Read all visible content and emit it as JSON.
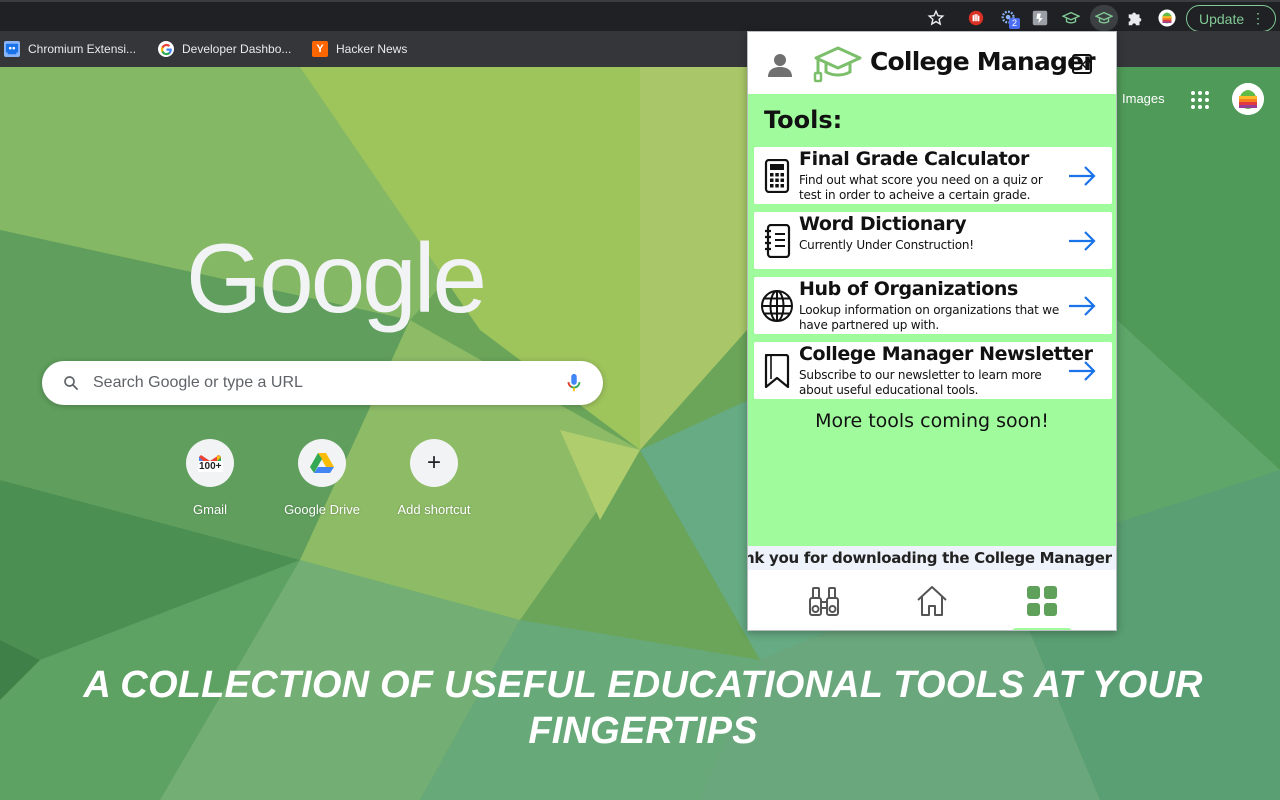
{
  "browser": {
    "update_label": "Update",
    "more_icon": "more-vert-icon"
  },
  "bookmarks": [
    {
      "label": "Chromium Extensi...",
      "icon": "chromium-extensions-favicon"
    },
    {
      "label": "Developer Dashbo...",
      "icon": "google-favicon"
    },
    {
      "label": "Hacker News",
      "icon": "hacker-news-favicon",
      "badge": "Y"
    }
  ],
  "ntp": {
    "logo": "Google",
    "images_link": "Images",
    "search_placeholder": "Search Google or type a URL",
    "shortcuts": [
      {
        "label": "Gmail",
        "badge": "100+"
      },
      {
        "label": "Google Drive"
      },
      {
        "label": "Add shortcut",
        "glyph": "+"
      }
    ]
  },
  "extension_badge": "2",
  "popup": {
    "title": "College Manager",
    "tools_heading": "Tools:",
    "tools": [
      {
        "title": "Final Grade Calculator",
        "desc": "Find out what score you need on a quiz or test in order to acheive a certain grade.",
        "icon": "calculator-icon"
      },
      {
        "title": "Word Dictionary",
        "desc": "Currently Under Construction!",
        "icon": "notebook-icon"
      },
      {
        "title": "Hub of Organizations",
        "desc": "Lookup information on organizations that we have partnered up with.",
        "icon": "globe-icon"
      },
      {
        "title": "College Manager Newsletter",
        "desc": "Subscribe to our newsletter to learn more about useful educational tools.",
        "icon": "bookmark-icon"
      }
    ],
    "more_text": "More tools coming soon!",
    "marquee": "nk you for downloading the College Manager Chrome Extension!",
    "nav": [
      "binoculars-icon",
      "home-icon",
      "grid-icon"
    ]
  },
  "tagline": {
    "line1": "A COLLECTION OF USEFUL EDUCATIONAL TOOLS AT YOUR",
    "line2": "FINGERTIPS"
  },
  "colors": {
    "popup_bg": "#a0fb9c",
    "arrow": "#1a73e8",
    "update_green": "#81c995"
  }
}
